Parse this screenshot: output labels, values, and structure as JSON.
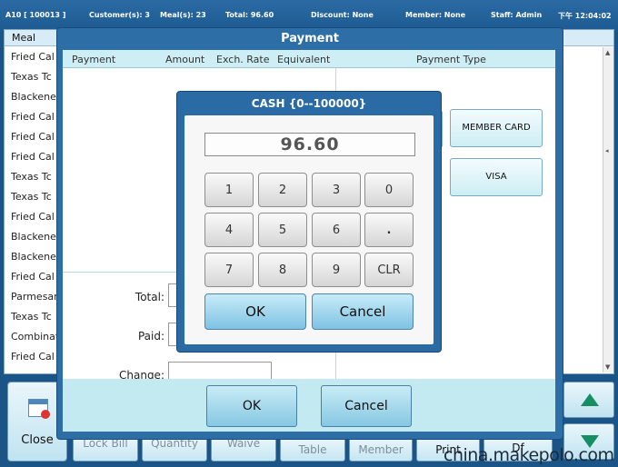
{
  "statusbar": {
    "table": "A10 [ 100013 ]",
    "customers": "Customer(s): 3",
    "meals": "Meal(s): 23",
    "total": "Total: 96.60",
    "discount": "Discount: None",
    "member": "Member: None",
    "staff": "Staff: Admin",
    "time": "下午 12:04:02"
  },
  "meal_panel": {
    "header": "Meal",
    "items": [
      "Fried Cal",
      "Texas Tc",
      "Blackene",
      "Fried Cal",
      "Fried Cal",
      "Fried Cal",
      "Texas Tc",
      "Texas Tc",
      "Fried Cal",
      "Blackene",
      "Blackene",
      "Fried Cal",
      "Parmesar",
      "Texas Tc",
      "Combinat",
      "Fried Cal"
    ]
  },
  "bottom_bar": {
    "close_label": "Close",
    "lock_bill": "Lock Bill",
    "quantity": "Quantity",
    "waive": "Waive",
    "table": "Table",
    "member": "Member",
    "print": "Print",
    "df": "Df"
  },
  "payment_dialog": {
    "title": "Payment",
    "columns": {
      "payment": "Payment",
      "amount": "Amount",
      "exch_rate": "Exch. Rate",
      "equivalent": "Equivalent",
      "payment_type": "Payment Type"
    },
    "total_label": "Total:",
    "paid_label": "Paid:",
    "change_label": "Change:",
    "payment_types": [
      "MEMBER CARD",
      "VISA"
    ],
    "ok_label": "OK",
    "cancel_label": "Cancel"
  },
  "cash_dialog": {
    "title": "CASH {0--100000}",
    "amount": "96.60",
    "keys": [
      "1",
      "2",
      "3",
      "0",
      "4",
      "5",
      "6",
      ".",
      "7",
      "8",
      "9",
      "CLR"
    ],
    "ok_label": "OK",
    "cancel_label": "Cancel"
  },
  "watermark": "china.makepolo.com",
  "colors": {
    "frame_blue": "#2d6ea6",
    "header_cyan": "#cdeef4",
    "button_cyan": "#86c7e2",
    "arrow_green": "#148f63"
  }
}
